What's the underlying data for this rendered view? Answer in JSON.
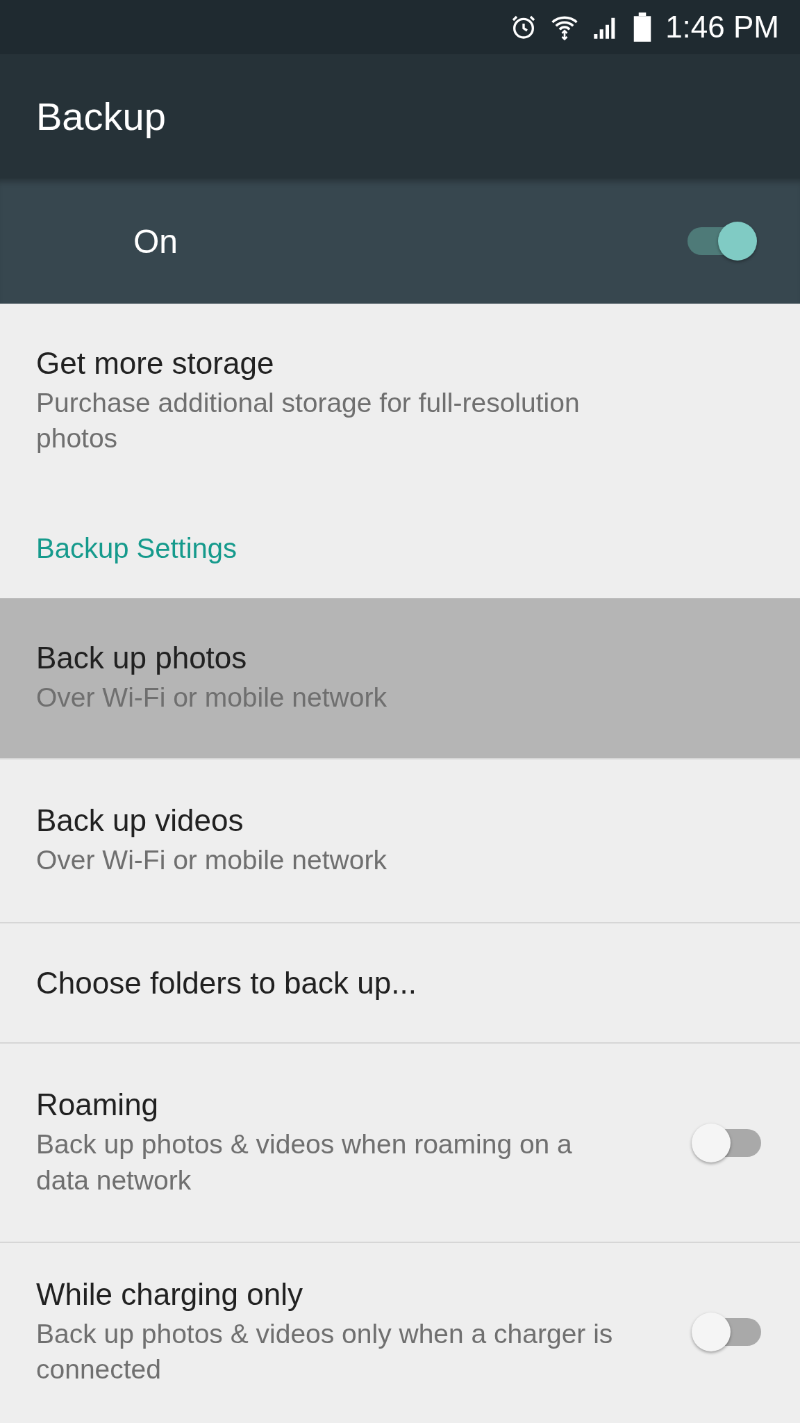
{
  "status_bar": {
    "time": "1:46 PM"
  },
  "toolbar": {
    "title": "Backup"
  },
  "master_switch": {
    "label": "On",
    "on": true
  },
  "items": [
    {
      "kind": "text",
      "title": "Get more storage",
      "subtitle": "Purchase additional storage for full-resolution photos",
      "highlighted": false
    },
    {
      "kind": "header",
      "title": "Backup Settings"
    },
    {
      "kind": "text",
      "title": "Back up photos",
      "subtitle": "Over Wi-Fi or mobile network",
      "highlighted": true
    },
    {
      "kind": "text",
      "title": "Back up videos",
      "subtitle": "Over Wi-Fi or mobile network",
      "highlighted": false
    },
    {
      "kind": "text",
      "title": "Choose folders to back up...",
      "highlighted": false
    },
    {
      "kind": "switch",
      "title": "Roaming",
      "subtitle": "Back up photos & videos when roaming on a data network",
      "on": false,
      "highlighted": false
    },
    {
      "kind": "switch",
      "title": "While charging only",
      "subtitle": "Back up photos & videos only when a charger is connected",
      "on": false,
      "highlighted": false
    }
  ]
}
